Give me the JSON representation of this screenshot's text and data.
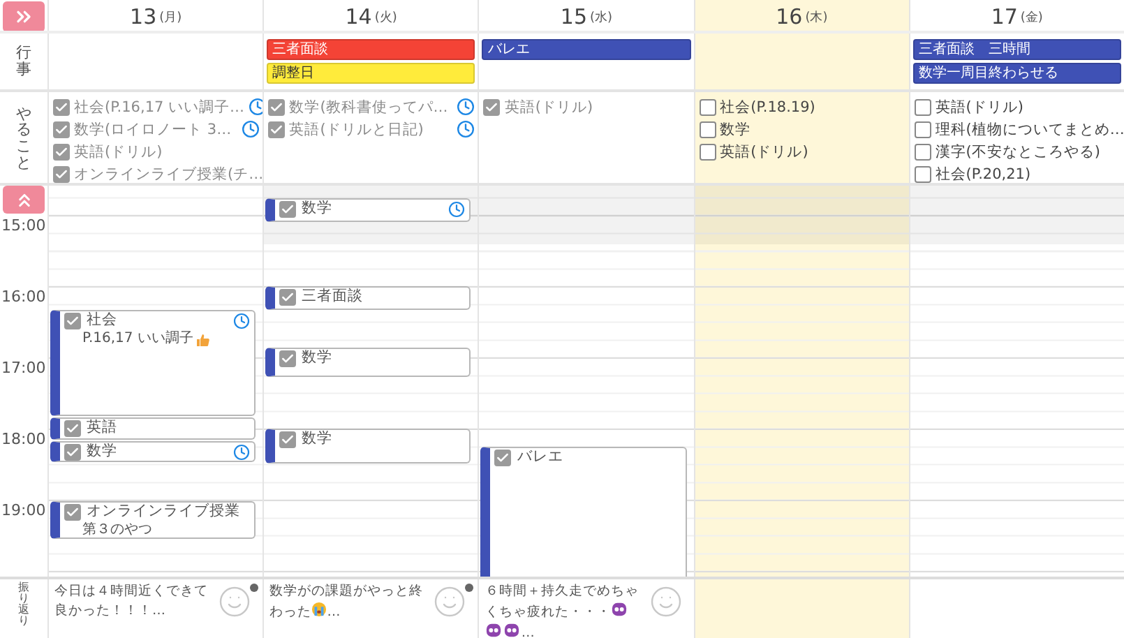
{
  "row_labels": {
    "events": "行事",
    "todos": "やること",
    "reflection": "振り返り"
  },
  "time_labels": [
    "15:00",
    "16:00",
    "17:00",
    "18:00",
    "19:00"
  ],
  "days": [
    {
      "date": "13",
      "weekday": "(月)",
      "today": false,
      "shaded": false,
      "todos": [
        {
          "text": "社会(P.16,17 いい調子…",
          "checked": true,
          "reminder": true
        },
        {
          "text": "数学(ロイロノート 3…",
          "checked": true,
          "reminder": true
        },
        {
          "text": "英語(ドリル)",
          "checked": true,
          "reminder": false
        },
        {
          "text": "オンラインライブ授業(チ…",
          "checked": true,
          "reminder": false
        }
      ],
      "schedule": [
        {
          "title": "社会",
          "checked": true,
          "reminder": true,
          "note": "P.16,17 いい調子",
          "note_icon": {
            "kind": "thumbs-up"
          }
        },
        {
          "title": "英語",
          "checked": true,
          "reminder": false
        },
        {
          "title": "数学",
          "checked": true,
          "reminder": true
        },
        {
          "title": "オンラインライブ授業",
          "checked": true,
          "reminder": false,
          "note": "第３のやつ"
        }
      ],
      "reflection": {
        "text": "今日は４時間近くできて良かった！！！",
        "ellipsis": "…",
        "marked": true
      }
    },
    {
      "date": "14",
      "weekday": "(火)",
      "today": false,
      "shaded": true,
      "events": [
        {
          "title": "三者面談",
          "color": "#f44336"
        },
        {
          "title": "調整日",
          "color": "#ffeb3b"
        }
      ],
      "todos": [
        {
          "text": "数学(教科書使ってパ…",
          "checked": true,
          "reminder": true
        },
        {
          "text": "英語(ドリルと日記)",
          "checked": true,
          "reminder": true
        }
      ],
      "schedule": [
        {
          "title": "数学",
          "checked": true,
          "reminder": true
        },
        {
          "title": "三者面談",
          "checked": true,
          "reminder": false
        },
        {
          "title": "数学",
          "checked": true,
          "reminder": false
        },
        {
          "title": "数学",
          "checked": true,
          "reminder": false
        }
      ],
      "reflection": {
        "text": "数学がの課題がやっと終わった",
        "emoji": [
          {
            "kind": "crying"
          }
        ],
        "ellipsis": "…",
        "marked": true
      }
    },
    {
      "date": "15",
      "weekday": "(水)",
      "today": false,
      "shaded": true,
      "events": [
        {
          "title": "バレエ",
          "color": "#3f51b5"
        }
      ],
      "todos": [
        {
          "text": "英語(ドリル)",
          "checked": true,
          "reminder": false
        }
      ],
      "schedule": [
        {
          "title": "バレエ",
          "checked": true,
          "reminder": false
        }
      ],
      "reflection": {
        "text": "６時間＋持久走でめちゃくちゃ疲れた・・・",
        "emoji": [
          {
            "kind": "alien"
          },
          {
            "kind": "alien"
          },
          {
            "kind": "alien"
          }
        ],
        "ellipsis": "…",
        "marked": false
      }
    },
    {
      "date": "16",
      "weekday": "(木)",
      "today": true,
      "shaded": true,
      "todos": [
        {
          "text": "社会(P.18.19)",
          "checked": false,
          "reminder": false
        },
        {
          "text": "数学",
          "checked": false,
          "reminder": false
        },
        {
          "text": "英語(ドリル)",
          "checked": false,
          "reminder": false
        }
      ]
    },
    {
      "date": "17",
      "weekday": "(金)",
      "today": false,
      "shaded": true,
      "events": [
        {
          "title": "三者面談　三時間",
          "color": "#3f51b5"
        },
        {
          "title": "数学一周目終わらせる",
          "color": "#3f51b5"
        }
      ],
      "todos": [
        {
          "text": "英語(ドリル)",
          "checked": false,
          "reminder": false
        },
        {
          "text": "理科(植物についてまとめ…",
          "checked": false,
          "reminder": false
        },
        {
          "text": "漢字(不安なところやる)",
          "checked": false,
          "reminder": false
        },
        {
          "text": "社会(P.20,21)",
          "checked": false,
          "reminder": false
        }
      ]
    }
  ]
}
